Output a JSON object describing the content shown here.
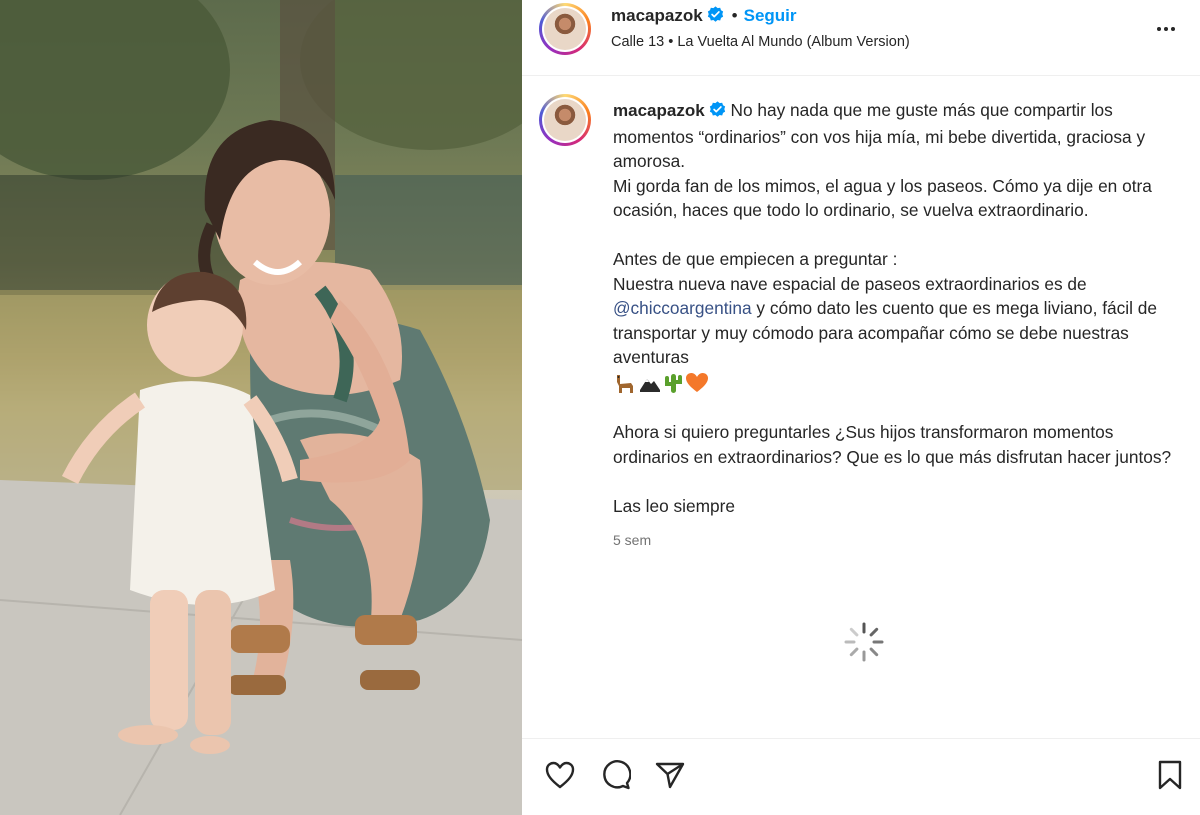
{
  "post": {
    "username": "macapazok",
    "follow_label": "Seguir",
    "separator": "•",
    "music": "Calle 13 • La Vuelta Al Mundo (Album Version)",
    "more_icon": "more-horizontal-icon"
  },
  "caption": {
    "username": "macapazok",
    "line1": "No hay nada que me guste más que compartir los momentos “ordinarios” con vos hija mía, mi bebe divertida, graciosa y amorosa.",
    "line2": "Mi gorda fan de los mimos, el agua y los paseos. Cómo ya dije en otra ocasión, haces que todo lo ordinario, se vuelva extraordinario.",
    "line3": "Antes de que empiecen a preguntar :",
    "line4_pre": "Nuestra nueva nave espacial de paseos extraordinarios es de ",
    "mention": "@chiccoargentina",
    "line4_post": " y cómo dato les cuento que es mega liviano, fácil de transportar y muy cómodo para acompañar cómo se debe nuestras aventuras",
    "emojis": [
      "llama-emoji",
      "mountain-emoji",
      "cactus-emoji",
      "orange-heart-emoji"
    ],
    "line5": "Ahora si quiero preguntarles ¿Sus hijos transformaron momentos ordinarios en extraordinarios? Que es lo que más disfrutan hacer juntos?",
    "line6": "Las leo siempre",
    "timestamp": "5 sem"
  },
  "actions": [
    "like-icon",
    "comment-icon",
    "share-icon",
    "save-icon"
  ],
  "colors": {
    "accent": "#0095f6",
    "verified": "#0095f6",
    "mention": "#385185",
    "text": "#262626",
    "muted": "#737373"
  }
}
